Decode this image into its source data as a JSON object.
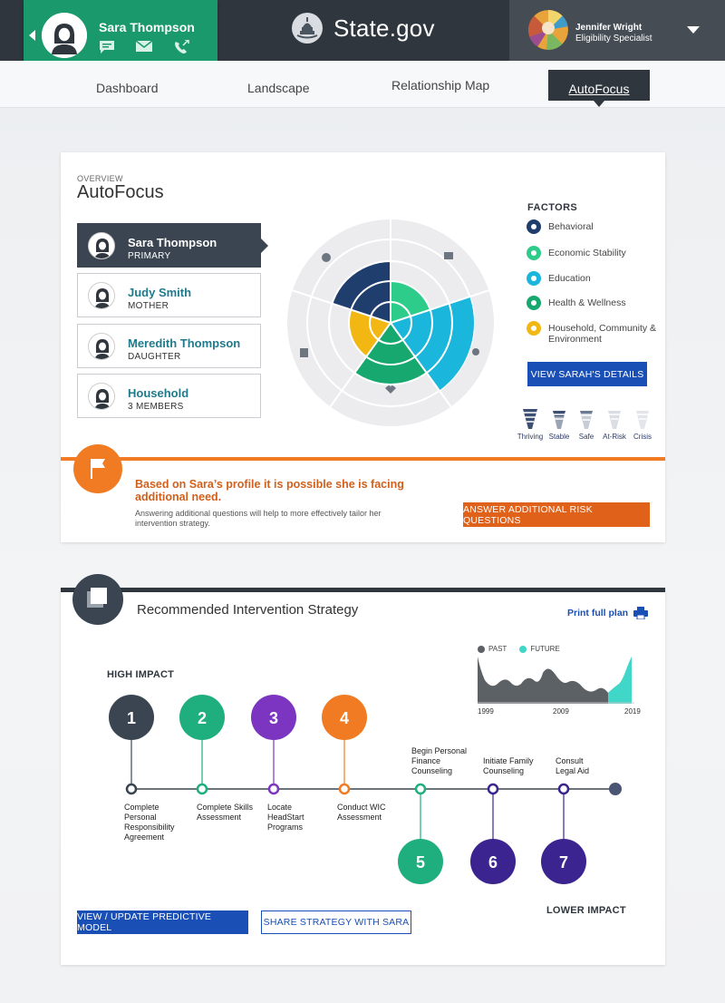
{
  "header": {
    "client_name": "Sara Thompson",
    "site_title": "State.gov",
    "user_name": "Jennifer Wright",
    "user_role": "Eligibility Specialist",
    "client_icons": [
      "chat-icon",
      "mail-icon",
      "phone-icon"
    ]
  },
  "nav": {
    "items": [
      "Dashboard",
      "Landscape",
      "Relationship Map",
      "AutoFocus"
    ],
    "active": "AutoFocus"
  },
  "overview": {
    "label": "OVERVIEW",
    "title": "AutoFocus",
    "people": [
      {
        "name": "Sara Thompson",
        "role": "PRIMARY",
        "primary": true
      },
      {
        "name": "Judy Smith",
        "role": "MOTHER"
      },
      {
        "name": "Meredith Thompson",
        "role": "DAUGHTER"
      },
      {
        "name": "Household",
        "role": "3 MEMBERS"
      }
    ],
    "factors_title": "FACTORS",
    "factors": [
      {
        "label": "Behavioral",
        "color": "#1f3e6e",
        "icon": "star-icon"
      },
      {
        "label": "Economic Stability",
        "color": "#2ecc8b",
        "icon": "chart-icon"
      },
      {
        "label": "Education",
        "color": "#1ab6db",
        "icon": "lightbulb-icon"
      },
      {
        "label": "Health & Wellness",
        "color": "#17a86f",
        "icon": "heart-icon"
      },
      {
        "label": "Household, Community & Environment",
        "color": "#f2b712",
        "icon": "building-icon"
      }
    ],
    "details_button": "VIEW SARAH'S DETAILS",
    "levels": [
      "Thriving",
      "Stable",
      "Safe",
      "At-Risk",
      "Crisis"
    ],
    "alert": {
      "heading": "Based on Sara’s profile it is possible she is facing additional need.",
      "body": "Answering additional questions will help to more effectively tailor her intervention strategy.",
      "button": "ANSWER ADDITIONAL RISK QUESTIONS"
    }
  },
  "strategy": {
    "title": "Recommended Intervention Strategy",
    "print_label": "Print full plan",
    "high_impact": "HIGH IMPACT",
    "lower_impact": "LOWER IMPACT",
    "legend": {
      "past": "PAST",
      "future": "FUTURE",
      "past_color": "#5c6166",
      "future_color": "#40d6c8"
    },
    "years": [
      "1999",
      "2009",
      "2019"
    ],
    "steps": [
      {
        "num": "1",
        "label": "Complete Personal Responsibility Agreement",
        "color": "#3a4551",
        "pos": "top"
      },
      {
        "num": "2",
        "label": "Complete Skills Assessment",
        "color": "#1fae7e",
        "pos": "top"
      },
      {
        "num": "3",
        "label": "Locate HeadStart Programs",
        "color": "#7b35c1",
        "pos": "top"
      },
      {
        "num": "4",
        "label": "Conduct WIC Assessment",
        "color": "#f07b22",
        "pos": "top"
      },
      {
        "num": "5",
        "label": "Begin Personal Finance Counseling",
        "color": "#1fae7e",
        "pos": "bottom"
      },
      {
        "num": "6",
        "label": "Initiate Family Counseling",
        "color": "#3b2390",
        "pos": "bottom"
      },
      {
        "num": "7",
        "label": "Consult Legal Aid",
        "color": "#3b2390",
        "pos": "bottom"
      }
    ],
    "model_button": "VIEW / UPDATE PREDICTIVE MODEL",
    "share_button": "SHARE STRATEGY WITH SARA"
  }
}
